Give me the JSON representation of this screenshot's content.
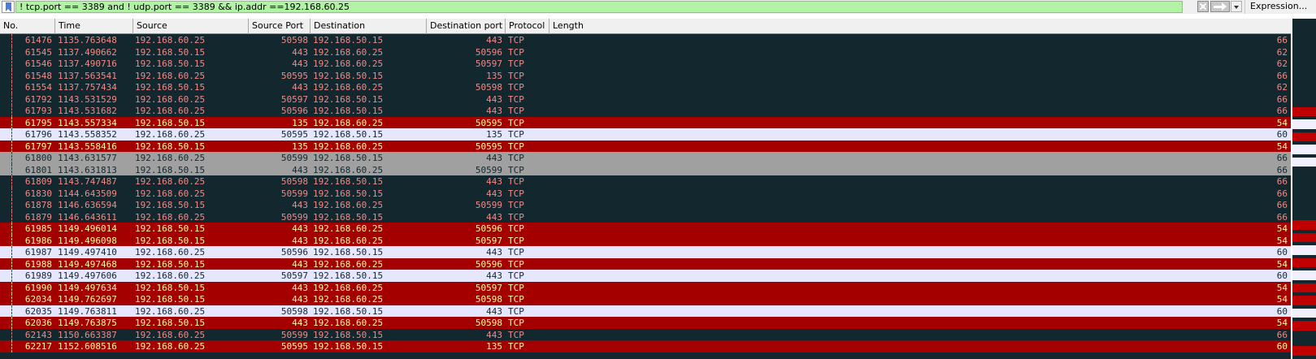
{
  "filter": {
    "value": "! tcp.port == 3389 and ! udp.port == 3389 && ip.addr ==192.168.60.25",
    "expression_label": "Expression..."
  },
  "columns": [
    "No.",
    "Time",
    "Source",
    "Source Port",
    "Destination",
    "Destination port",
    "Protocol",
    "Length"
  ],
  "colors": {
    "dark": {
      "bg": "#12272e",
      "fg": "#f28a86"
    },
    "red": {
      "bg": "#a40000",
      "fg": "#fffc9c"
    },
    "light": {
      "bg": "#e7e6ff",
      "fg": "#12272e"
    },
    "gray": {
      "bg": "#a0a0a0",
      "fg": "#12272e"
    }
  },
  "packets": [
    {
      "no": "61476",
      "time": "1135.763648",
      "src": "192.168.60.25",
      "sport": "50598",
      "dst": "192.168.50.15",
      "dport": "443",
      "proto": "TCP",
      "len": "66",
      "style": "dark"
    },
    {
      "no": "61545",
      "time": "1137.490662",
      "src": "192.168.50.15",
      "sport": "443",
      "dst": "192.168.60.25",
      "dport": "50596",
      "proto": "TCP",
      "len": "62",
      "style": "dark"
    },
    {
      "no": "61546",
      "time": "1137.490716",
      "src": "192.168.50.15",
      "sport": "443",
      "dst": "192.168.60.25",
      "dport": "50597",
      "proto": "TCP",
      "len": "62",
      "style": "dark"
    },
    {
      "no": "61548",
      "time": "1137.563541",
      "src": "192.168.60.25",
      "sport": "50595",
      "dst": "192.168.50.15",
      "dport": "135",
      "proto": "TCP",
      "len": "66",
      "style": "dark"
    },
    {
      "no": "61554",
      "time": "1137.757434",
      "src": "192.168.50.15",
      "sport": "443",
      "dst": "192.168.60.25",
      "dport": "50598",
      "proto": "TCP",
      "len": "62",
      "style": "dark"
    },
    {
      "no": "61792",
      "time": "1143.531529",
      "src": "192.168.60.25",
      "sport": "50597",
      "dst": "192.168.50.15",
      "dport": "443",
      "proto": "TCP",
      "len": "66",
      "style": "dark"
    },
    {
      "no": "61793",
      "time": "1143.531682",
      "src": "192.168.60.25",
      "sport": "50596",
      "dst": "192.168.50.15",
      "dport": "443",
      "proto": "TCP",
      "len": "66",
      "style": "dark"
    },
    {
      "no": "61795",
      "time": "1143.557334",
      "src": "192.168.50.15",
      "sport": "135",
      "dst": "192.168.60.25",
      "dport": "50595",
      "proto": "TCP",
      "len": "54",
      "style": "red"
    },
    {
      "no": "61796",
      "time": "1143.558352",
      "src": "192.168.60.25",
      "sport": "50595",
      "dst": "192.168.50.15",
      "dport": "135",
      "proto": "TCP",
      "len": "60",
      "style": "light"
    },
    {
      "no": "61797",
      "time": "1143.558416",
      "src": "192.168.50.15",
      "sport": "135",
      "dst": "192.168.60.25",
      "dport": "50595",
      "proto": "TCP",
      "len": "54",
      "style": "red"
    },
    {
      "no": "61800",
      "time": "1143.631577",
      "src": "192.168.60.25",
      "sport": "50599",
      "dst": "192.168.50.15",
      "dport": "443",
      "proto": "TCP",
      "len": "66",
      "style": "gray"
    },
    {
      "no": "61801",
      "time": "1143.631813",
      "src": "192.168.50.15",
      "sport": "443",
      "dst": "192.168.60.25",
      "dport": "50599",
      "proto": "TCP",
      "len": "66",
      "style": "gray"
    },
    {
      "no": "61809",
      "time": "1143.747487",
      "src": "192.168.60.25",
      "sport": "50598",
      "dst": "192.168.50.15",
      "dport": "443",
      "proto": "TCP",
      "len": "66",
      "style": "dark"
    },
    {
      "no": "61830",
      "time": "1144.643509",
      "src": "192.168.60.25",
      "sport": "50599",
      "dst": "192.168.50.15",
      "dport": "443",
      "proto": "TCP",
      "len": "66",
      "style": "dark"
    },
    {
      "no": "61878",
      "time": "1146.636594",
      "src": "192.168.50.15",
      "sport": "443",
      "dst": "192.168.60.25",
      "dport": "50599",
      "proto": "TCP",
      "len": "66",
      "style": "dark"
    },
    {
      "no": "61879",
      "time": "1146.643611",
      "src": "192.168.60.25",
      "sport": "50599",
      "dst": "192.168.50.15",
      "dport": "443",
      "proto": "TCP",
      "len": "66",
      "style": "dark"
    },
    {
      "no": "61985",
      "time": "1149.496014",
      "src": "192.168.50.15",
      "sport": "443",
      "dst": "192.168.60.25",
      "dport": "50596",
      "proto": "TCP",
      "len": "54",
      "style": "red"
    },
    {
      "no": "61986",
      "time": "1149.496098",
      "src": "192.168.50.15",
      "sport": "443",
      "dst": "192.168.60.25",
      "dport": "50597",
      "proto": "TCP",
      "len": "54",
      "style": "red"
    },
    {
      "no": "61987",
      "time": "1149.497410",
      "src": "192.168.60.25",
      "sport": "50596",
      "dst": "192.168.50.15",
      "dport": "443",
      "proto": "TCP",
      "len": "60",
      "style": "light"
    },
    {
      "no": "61988",
      "time": "1149.497468",
      "src": "192.168.50.15",
      "sport": "443",
      "dst": "192.168.60.25",
      "dport": "50596",
      "proto": "TCP",
      "len": "54",
      "style": "red"
    },
    {
      "no": "61989",
      "time": "1149.497606",
      "src": "192.168.60.25",
      "sport": "50597",
      "dst": "192.168.50.15",
      "dport": "443",
      "proto": "TCP",
      "len": "60",
      "style": "light"
    },
    {
      "no": "61990",
      "time": "1149.497634",
      "src": "192.168.50.15",
      "sport": "443",
      "dst": "192.168.60.25",
      "dport": "50597",
      "proto": "TCP",
      "len": "54",
      "style": "red"
    },
    {
      "no": "62034",
      "time": "1149.762697",
      "src": "192.168.50.15",
      "sport": "443",
      "dst": "192.168.60.25",
      "dport": "50598",
      "proto": "TCP",
      "len": "54",
      "style": "red"
    },
    {
      "no": "62035",
      "time": "1149.763811",
      "src": "192.168.60.25",
      "sport": "50598",
      "dst": "192.168.50.15",
      "dport": "443",
      "proto": "TCP",
      "len": "60",
      "style": "light"
    },
    {
      "no": "62036",
      "time": "1149.763875",
      "src": "192.168.50.15",
      "sport": "443",
      "dst": "192.168.60.25",
      "dport": "50598",
      "proto": "TCP",
      "len": "54",
      "style": "red"
    },
    {
      "no": "62143",
      "time": "1150.663387",
      "src": "192.168.60.25",
      "sport": "50599",
      "dst": "192.168.50.15",
      "dport": "443",
      "proto": "TCP",
      "len": "66",
      "style": "dark"
    },
    {
      "no": "62217",
      "time": "1152.608516",
      "src": "192.168.60.25",
      "sport": "50595",
      "dst": "192.168.50.15",
      "dport": "135",
      "proto": "TCP",
      "len": "60",
      "style": "red"
    }
  ]
}
